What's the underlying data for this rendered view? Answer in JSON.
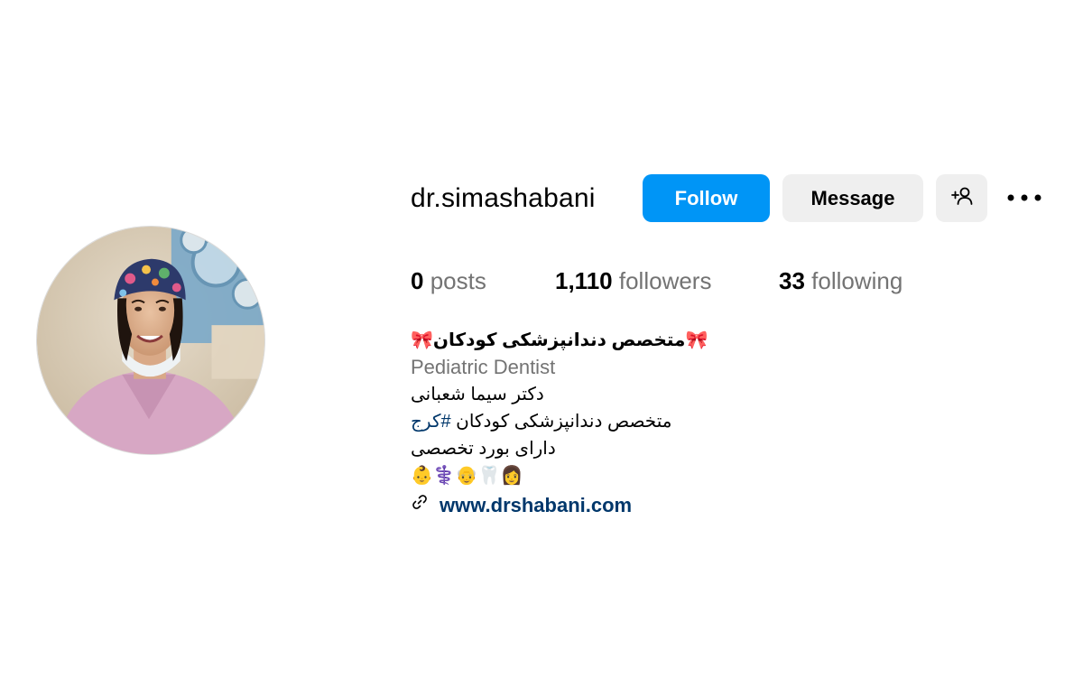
{
  "profile": {
    "username": "dr.simashabani",
    "follow_label": "Follow",
    "message_label": "Message",
    "stats": {
      "posts_count": "0",
      "posts_label": "posts",
      "followers_count": "1,110",
      "followers_label": "followers",
      "following_count": "33",
      "following_label": "following"
    },
    "bio": {
      "name_line": "🎀متخصص دندانپزشکی کودکان🎀",
      "category": "Pediatric Dentist",
      "line1": "دکتر سیما شعبانی",
      "line2_text": "متخصص دندانپزشکی کودکان ",
      "line2_hashtag": "#کرج",
      "line3": "دارای بورد تخصصی",
      "emoji_line": "👶⚕️👴🦷👩",
      "link": "www.drshabani.com"
    }
  },
  "colors": {
    "follow_button": "#0095f6",
    "secondary_button": "#efefef",
    "link": "#00376b",
    "muted_text": "#737373"
  },
  "icons": {
    "add_user": "add-person-icon",
    "more": "more-options-icon",
    "link": "link-icon"
  }
}
